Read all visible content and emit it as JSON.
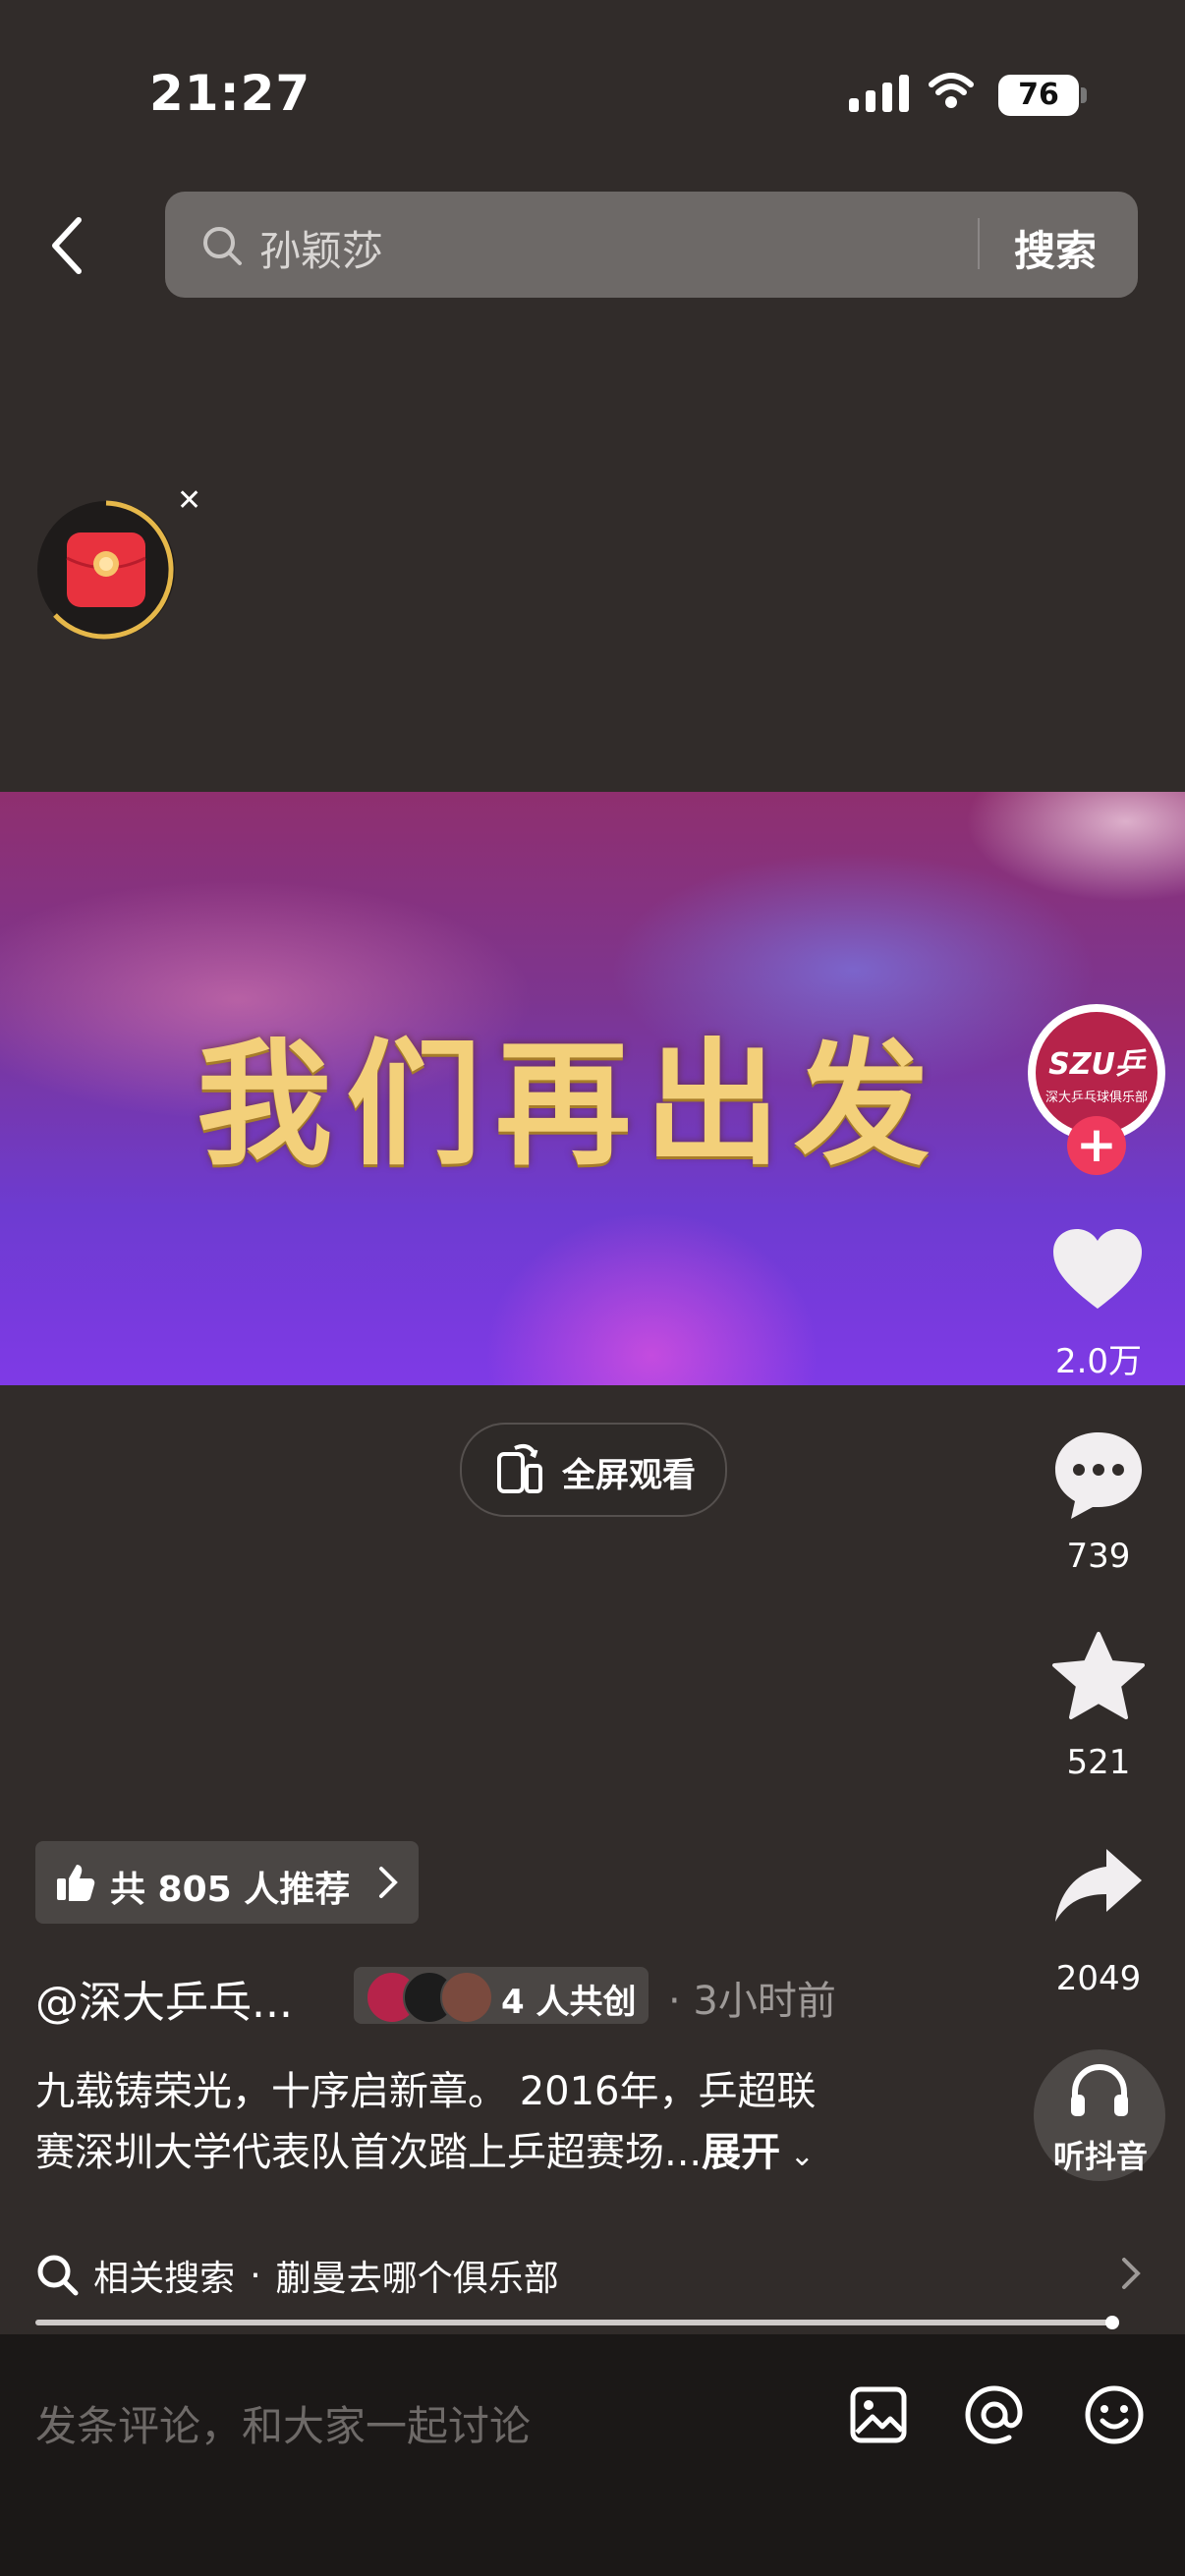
{
  "status_bar": {
    "time": "21:27",
    "battery": "76"
  },
  "search": {
    "query": "孙颖莎",
    "button": "搜索"
  },
  "video": {
    "title": "我们再出发",
    "fullscreen_label": "全屏观看",
    "gradient_top": "#8f2f6f",
    "gradient_bottom": "#7f3ae6"
  },
  "rail": {
    "avatar_logo": "SZU乒",
    "avatar_sub": "深大乒乓球俱乐部",
    "likes": "2.0万",
    "comments": "739",
    "favorites": "521",
    "shares": "2049",
    "listen_label": "听抖音"
  },
  "recommend": {
    "label": "共 805 人推荐"
  },
  "post": {
    "author": "@深大乒乓...",
    "collab": "4 人共创",
    "time_ago": "· 3小时前",
    "desc_line1": "九载铸荣光，十序启新章。 2016年，乒超联",
    "desc_line2": "赛深圳大学代表队首次踏上乒超赛场...",
    "expand": "展开"
  },
  "related": {
    "prefix": "相关搜索",
    "dot": "·",
    "query": "蒯曼去哪个俱乐部"
  },
  "progress": {
    "fraction": 0.996
  },
  "comment": {
    "placeholder": "发条评论，和大家一起讨论"
  },
  "colors": {
    "accent_red": "#ef3a5d",
    "background": "#312c2a",
    "gold_text": "#f3d07a"
  }
}
